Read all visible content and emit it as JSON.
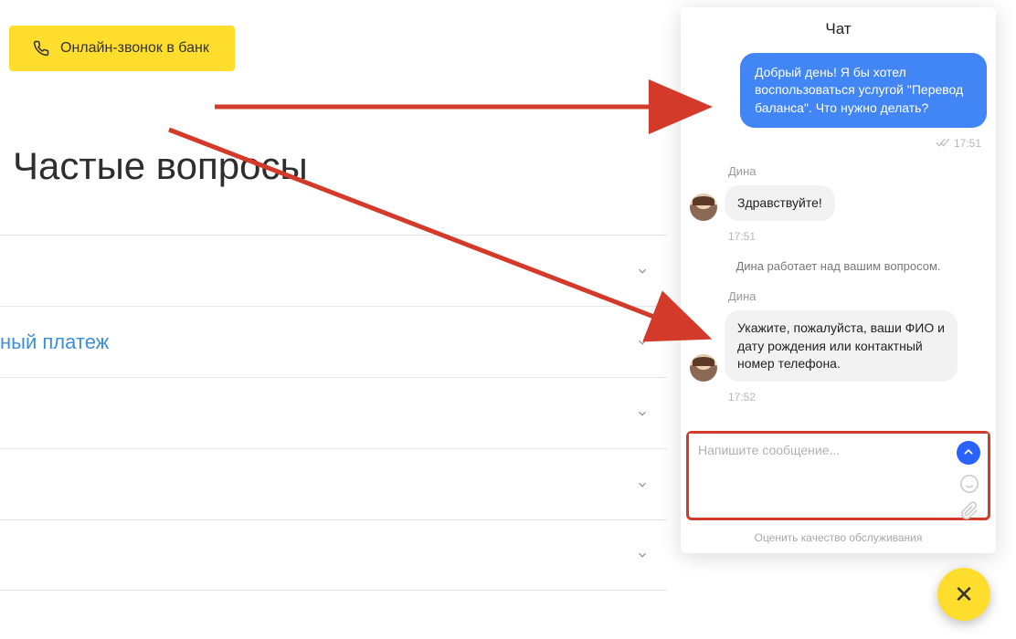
{
  "call_button": {
    "label": "Онлайн-звонок в банк"
  },
  "faq": {
    "title": "Частые вопросы",
    "link_fragment": "ный платеж"
  },
  "chat": {
    "title": "Чат",
    "user_message": "Добрый день! Я бы хотел воспользоваться услугой \"Перевод баланса\". Что нужно делать?",
    "user_time": "17:51",
    "agent_name_1": "Дина",
    "agent_msg_1": "Здравствуйте!",
    "agent_time_1": "17:51",
    "system_notice": "Дина работает над вашим вопросом.",
    "agent_name_2": "Дина",
    "agent_msg_2": "Укажите, пожалуйста, ваши ФИО и дату рождения или контактный номер телефона.",
    "agent_time_2": "17:52",
    "input_placeholder": "Напишите сообщение...",
    "rate_label": "Оценить качество обслуживания"
  },
  "close_fab": "✕"
}
